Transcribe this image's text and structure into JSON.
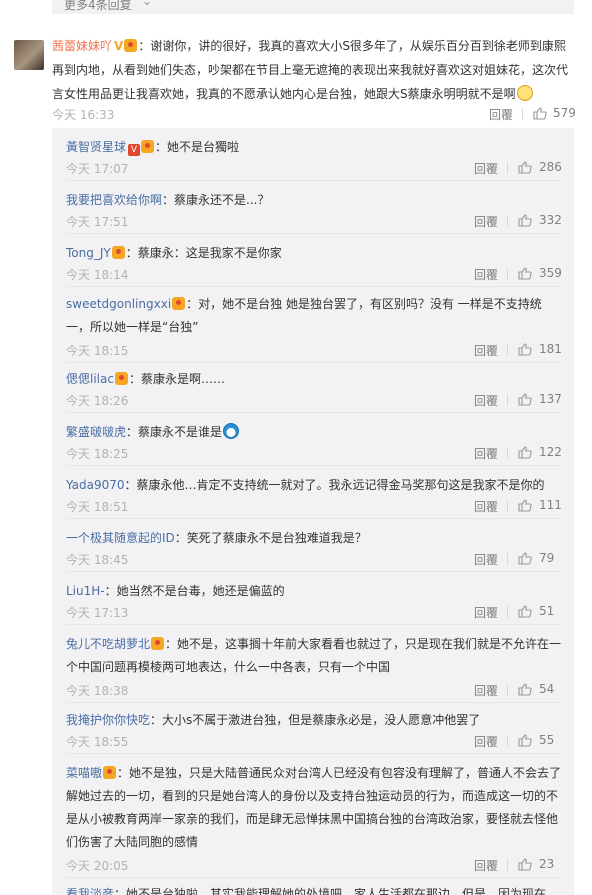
{
  "top": {
    "more_label": "更多4条回复",
    "chevron": "chevron-down-icon"
  },
  "main": {
    "user": "茜蕾妹妹吖",
    "text": "：谢谢你，讲的很好，我真的喜欢大小S很多年了，从娱乐百分百到徐老师到康熙再到内地，从看到她们失态，吵架都在节目上毫无遮掩的表现出来我就好喜欢这对姐妹花，这次代言女性用品更让我喜欢她，我真的不愿承认她内心是台独，她跟大S蔡康永明明就不是啊",
    "time": "今天 16:33",
    "reply": "回覆",
    "likes": "579"
  },
  "replies": [
    {
      "user": "黃智贤星球",
      "badges": [
        "v",
        "lvl"
      ],
      "text": "：她不是台獨啦",
      "time": "今天 17:07",
      "reply": "回覆",
      "likes": "286"
    },
    {
      "user": "我要把喜欢给你啊",
      "badges": [],
      "text": "：蔡康永还不是...？",
      "time": "今天 17:51",
      "reply": "回覆",
      "likes": "332"
    },
    {
      "user": "Tong_JY",
      "badges": [
        "lvl"
      ],
      "text": "：蔡康永：这是我家不是你家",
      "time": "今天 18:14",
      "reply": "回覆",
      "likes": "359"
    },
    {
      "user": "sweetdgonlingxxi",
      "badges": [
        "lvl"
      ],
      "text": "：对，她不是台独 她是独台罢了，有区别吗？没有 一样是不支持统一，所以她一样是“台独”",
      "time": "今天 18:15",
      "reply": "回覆",
      "likes": "181"
    },
    {
      "user": "偲偲lilac",
      "badges": [
        "lvl"
      ],
      "text": "：蔡康永是啊……",
      "time": "今天 18:26",
      "reply": "回覆",
      "likes": "137"
    },
    {
      "user": "繁盛啵啵虎",
      "badges": [],
      "text": "：蔡康永不是谁是",
      "time": "今天 18:25",
      "reply": "回覆",
      "likes": "122"
    },
    {
      "user": "Yada9070",
      "badges": [],
      "text": "：蔡康永他…肯定不支持统一就对了。我永远记得金马奖那句这是我家不是你的",
      "time": "今天 18:51",
      "reply": "回覆",
      "likes": "111"
    },
    {
      "user": "一个极其随意起的ID",
      "badges": [],
      "text": "：笑死了蔡康永不是台独难道我是？",
      "time": "今天 18:45",
      "reply": "回覆",
      "likes": "79"
    },
    {
      "user": "Liu1H-",
      "badges": [],
      "text": "：她当然不是台毒，她还是偏蓝的",
      "time": "今天 17:13",
      "reply": "回覆",
      "likes": "51"
    },
    {
      "user": "兔儿不吃胡萝北",
      "badges": [
        "lvl"
      ],
      "text": "：她不是，这事搁十年前大家看看也就过了，只是现在我们就是不允许在一个中国问题再模棱两可地表达，什么一中各表，只有一个中国",
      "time": "今天 18:38",
      "reply": "回覆",
      "likes": "54"
    },
    {
      "user": "我掩护你你快吃",
      "badges": [],
      "text": "：大小s不属于激进台独，但是蔡康永必是，没人愿意冲他罢了",
      "time": "今天 18:55",
      "reply": "回覆",
      "likes": "55"
    },
    {
      "user": "菜喵嗷",
      "badges": [
        "lvl"
      ],
      "text": "：她不是独，只是大陆普通民众对台湾人已经没有包容没有理解了，普通人不会去了解她过去的一切，看到的只是她台湾人的身份以及支持台独运动员的行为，而造成这一切的不是从小被教育两岸一家亲的我们，而是肆无忌惮抹黑中国搞台独的台湾政治家，要怪就去怪他们伤害了大陆同胞的感情",
      "time": "今天 20:05",
      "reply": "回覆",
      "likes": "23"
    },
    {
      "user": "看我淡彦",
      "badges": [],
      "text": "：她不是台独啦，其实我能理解她的处境吧，家人生活都在那边，但是，因为现在",
      "time": "",
      "reply": "",
      "likes": ""
    }
  ]
}
